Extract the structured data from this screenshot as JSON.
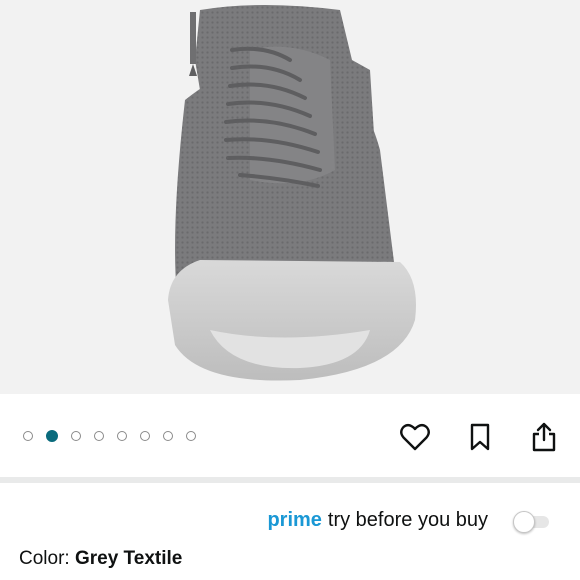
{
  "carousel": {
    "total": 8,
    "active_index": 1,
    "active_color": "#0a6b7d"
  },
  "actions": {
    "favorite_icon": "heart-outline-icon",
    "bookmark_icon": "bookmark-outline-icon",
    "share_icon": "share-icon"
  },
  "prime": {
    "brand": "prime",
    "label": "try before you buy",
    "brand_color": "#1a98d5",
    "toggle_on": false
  },
  "product": {
    "color_label": "Color: ",
    "color_value": "Grey Textile"
  }
}
